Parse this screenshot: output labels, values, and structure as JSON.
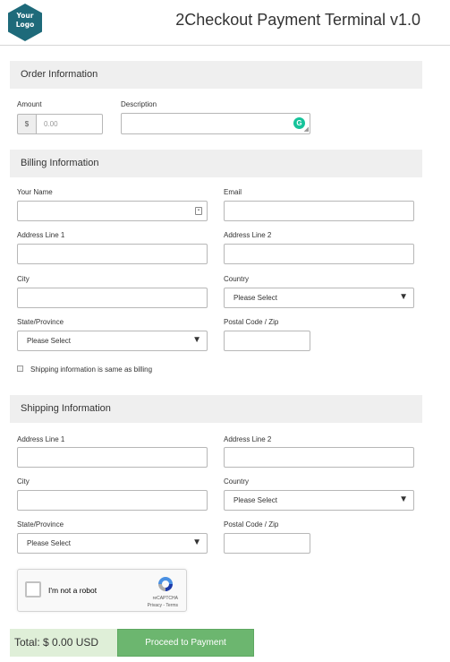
{
  "header": {
    "logo_line1": "Your",
    "logo_line2": "Logo",
    "title": "2Checkout Payment Terminal v1.0",
    "logo_color": "#1e6a7a"
  },
  "order": {
    "heading": "Order Information",
    "amount_label": "Amount",
    "currency_prefix": "$",
    "amount_placeholder": "0.00",
    "description_label": "Description",
    "grammarly_icon": "G"
  },
  "billing": {
    "heading": "Billing Information",
    "name_label": "Your Name",
    "email_label": "Email",
    "address1_label": "Address Line 1",
    "address2_label": "Address Line 2",
    "city_label": "City",
    "country_label": "Country",
    "country_value": "Please Select",
    "state_label": "State/Province",
    "state_value": "Please Select",
    "zip_label": "Postal Code / Zip",
    "same_as_billing_label": "Shipping information is same as billing"
  },
  "shipping": {
    "heading": "Shipping Information",
    "address1_label": "Address Line 1",
    "address2_label": "Address Line 2",
    "city_label": "City",
    "country_label": "Country",
    "country_value": "Please Select",
    "state_label": "State/Province",
    "state_value": "Please Select",
    "zip_label": "Postal Code / Zip"
  },
  "recaptcha": {
    "label": "I'm not a robot",
    "brand": "reCAPTCHA",
    "links": "Privacy - Terms"
  },
  "footer": {
    "total_label": "Total: $ 0.00  USD",
    "pay_button": "Proceed to Payment",
    "accent": "#6cb66f"
  },
  "icons": {
    "dropdown": "chevron-down-icon",
    "contact": "contact-card-icon",
    "resize": "resize-handle-icon"
  }
}
